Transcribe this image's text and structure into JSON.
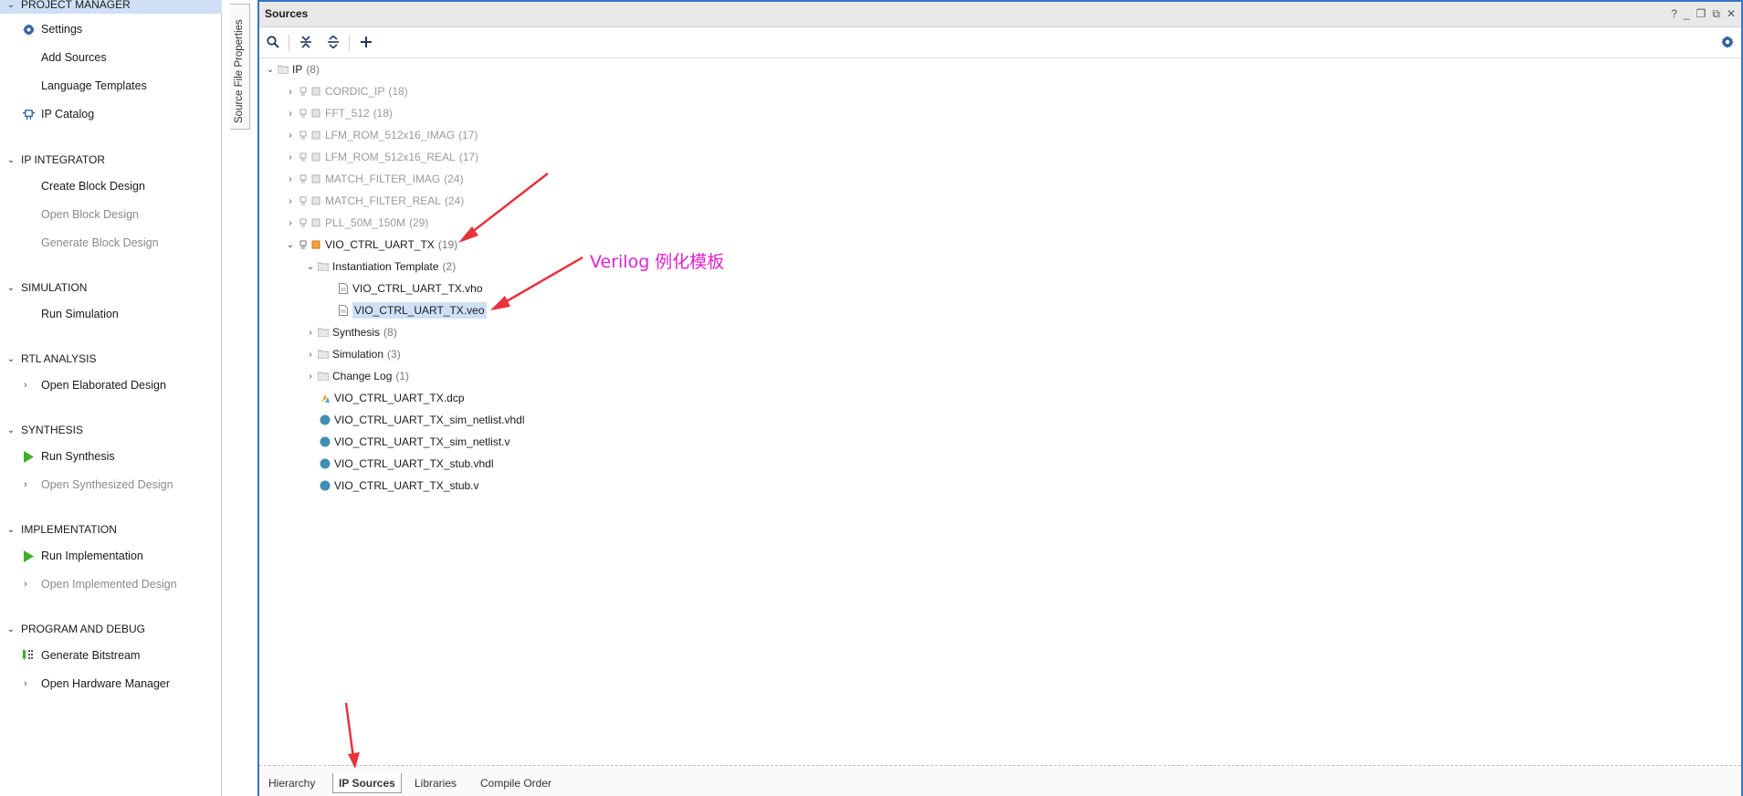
{
  "flow_navigator": {
    "sections": [
      {
        "label": "PROJECT MANAGER",
        "items": [
          {
            "label": "Settings",
            "icon": "gear-icon"
          },
          {
            "label": "Add Sources",
            "icon": ""
          },
          {
            "label": "Language Templates",
            "icon": ""
          },
          {
            "label": "IP Catalog",
            "icon": "ip-catalog-icon"
          }
        ]
      },
      {
        "label": "IP INTEGRATOR",
        "items": [
          {
            "label": "Create Block Design"
          },
          {
            "label": "Open Block Design"
          },
          {
            "label": "Generate Block Design"
          }
        ]
      },
      {
        "label": "SIMULATION",
        "items": [
          {
            "label": "Run Simulation"
          }
        ]
      },
      {
        "label": "RTL ANALYSIS",
        "items": [
          {
            "label": "Open Elaborated Design"
          }
        ]
      },
      {
        "label": "SYNTHESIS",
        "items": [
          {
            "label": "Run Synthesis",
            "icon": "play-icon"
          },
          {
            "label": "Open Synthesized Design"
          }
        ]
      },
      {
        "label": "IMPLEMENTATION",
        "items": [
          {
            "label": "Run Implementation",
            "icon": "play-icon"
          },
          {
            "label": "Open Implemented Design"
          }
        ]
      },
      {
        "label": "PROGRAM AND DEBUG",
        "items": [
          {
            "label": "Generate Bitstream",
            "icon": "bitstream-icon"
          },
          {
            "label": "Open Hardware Manager"
          }
        ]
      }
    ]
  },
  "side_tab": {
    "label": "Source File Properties"
  },
  "sources": {
    "title": "Sources",
    "header_buttons": [
      "?",
      "_",
      "❐",
      "⧉",
      "✕"
    ],
    "tree": {
      "root": {
        "name": "IP",
        "count": "(8)"
      },
      "ips": [
        {
          "name": "CORDIC_IP",
          "count": "(18)"
        },
        {
          "name": "FFT_512",
          "count": "(18)"
        },
        {
          "name": "LFM_ROM_512x16_IMAG",
          "count": "(17)"
        },
        {
          "name": "LFM_ROM_512x16_REAL",
          "count": "(17)"
        },
        {
          "name": "MATCH_FILTER_IMAG",
          "count": "(24)"
        },
        {
          "name": "MATCH_FILTER_REAL",
          "count": "(24)"
        },
        {
          "name": "PLL_50M_150M",
          "count": "(29)"
        },
        {
          "name": "VIO_CTRL_UART_TX",
          "count": "(19)"
        }
      ],
      "expanded": {
        "inst_template": {
          "name": "Instantiation Template",
          "count": "(2)"
        },
        "inst_files": [
          "VIO_CTRL_UART_TX.vho",
          "VIO_CTRL_UART_TX.veo"
        ],
        "folders": [
          {
            "name": "Synthesis",
            "count": "(8)"
          },
          {
            "name": "Simulation",
            "count": "(3)"
          },
          {
            "name": "Change Log",
            "count": "(1)"
          }
        ],
        "files": [
          "VIO_CTRL_UART_TX.dcp",
          "VIO_CTRL_UART_TX_sim_netlist.vhdl",
          "VIO_CTRL_UART_TX_sim_netlist.v",
          "VIO_CTRL_UART_TX_stub.vhdl",
          "VIO_CTRL_UART_TX_stub.v"
        ]
      }
    },
    "bottom_tabs": [
      "Hierarchy",
      "IP Sources",
      "Libraries",
      "Compile Order"
    ],
    "active_tab": "IP Sources"
  },
  "annotation": {
    "text": "Verilog 例化模板",
    "color": "#e020d0",
    "arrow_color": "#e8323c"
  }
}
